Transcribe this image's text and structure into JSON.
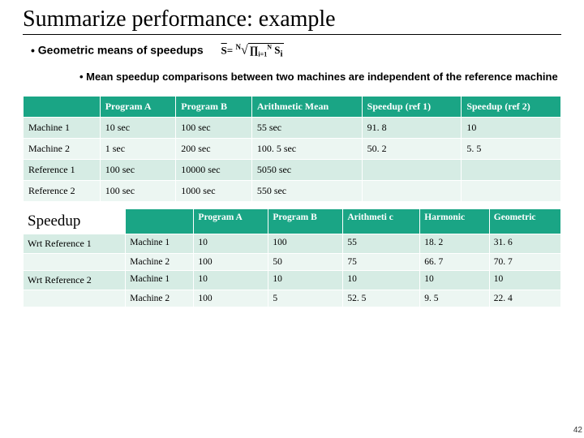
{
  "title": "Summarize performance: example",
  "bullet1": "Geometric means of speedups",
  "formula_text": "S̄ = ᴺ√(∏ i=1..N Sᵢ)",
  "bullet2": "Mean speedup comparisons between two machines are independent of the reference machine",
  "table1": {
    "headers": [
      "",
      "Program A",
      "Program B",
      "Arithmetic Mean",
      "Speedup (ref 1)",
      "Speedup (ref 2)"
    ],
    "rows": [
      [
        "Machine 1",
        "10 sec",
        "100 sec",
        "55 sec",
        "91. 8",
        "10"
      ],
      [
        "Machine 2",
        "1 sec",
        "200 sec",
        "100. 5 sec",
        "50. 2",
        "5. 5"
      ],
      [
        "Reference 1",
        "100 sec",
        "10000 sec",
        "5050 sec",
        "",
        ""
      ],
      [
        "Reference 2",
        "100 sec",
        "1000 sec",
        "550 sec",
        "",
        ""
      ]
    ]
  },
  "table2": {
    "title": "Speedup",
    "headers": [
      "",
      "",
      "Program A",
      "Program B",
      "Arithmeti c",
      "Harmonic",
      "Geometric"
    ],
    "rows": [
      [
        "Wrt Reference 1",
        "Machine 1",
        "10",
        "100",
        "55",
        "18. 2",
        "31. 6"
      ],
      [
        "",
        "Machine 2",
        "100",
        "50",
        "75",
        "66. 7",
        "70. 7"
      ],
      [
        "Wrt Reference 2",
        "Machine 1",
        "10",
        "10",
        "10",
        "10",
        "10"
      ],
      [
        "",
        "Machine 2",
        "100",
        "5",
        "52. 5",
        "9. 5",
        "22. 4"
      ]
    ]
  },
  "pagenum": "42"
}
